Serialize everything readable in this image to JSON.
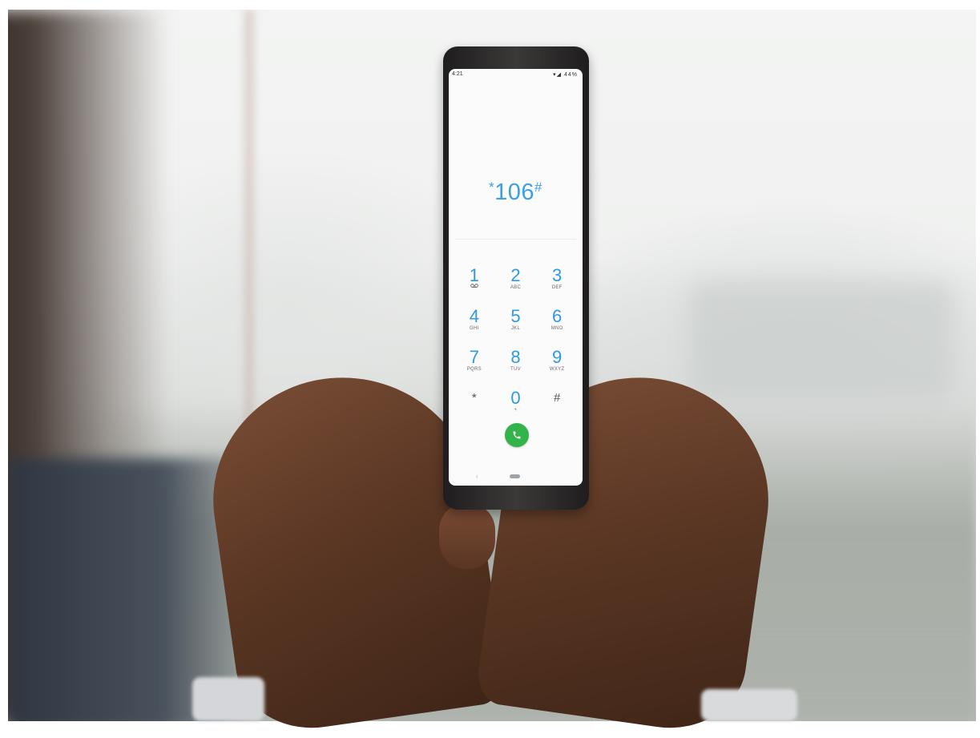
{
  "phone": {
    "status_time": "4:21",
    "status_icons": "▾◢ 44%",
    "dialed_prefix": "*",
    "dialed_number": "106",
    "dialed_suffix": "#",
    "keys": [
      {
        "digit": "1",
        "sub": ""
      },
      {
        "digit": "2",
        "sub": "ABC"
      },
      {
        "digit": "3",
        "sub": "DEF"
      },
      {
        "digit": "4",
        "sub": "GHI"
      },
      {
        "digit": "5",
        "sub": "JKL"
      },
      {
        "digit": "6",
        "sub": "MNO"
      },
      {
        "digit": "7",
        "sub": "PQRS"
      },
      {
        "digit": "8",
        "sub": "TUV"
      },
      {
        "digit": "9",
        "sub": "WXYZ"
      },
      {
        "digit": "*",
        "sub": ""
      },
      {
        "digit": "0",
        "sub": "+"
      },
      {
        "digit": "#",
        "sub": ""
      }
    ],
    "nav_back": "‹",
    "accent_color": "#3aa0e6",
    "call_color": "#33b44a",
    "call_icon": "phone-icon",
    "voicemail_icon": "voicemail-icon"
  }
}
